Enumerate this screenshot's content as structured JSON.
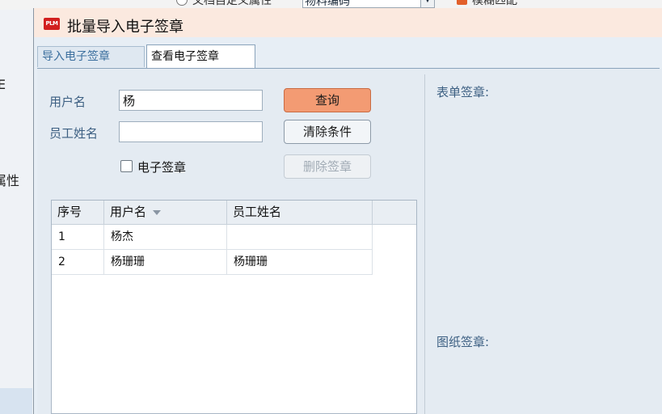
{
  "background": {
    "top_option_label": "文档自定义属性",
    "top_combo_value": "物料编码",
    "top_check_label": "模糊匹配",
    "left_texts": [
      "E",
      "属性"
    ]
  },
  "dialog": {
    "icon_text": "PLM",
    "title": "批量导入电子签章",
    "tabs": [
      {
        "label": "导入电子签章",
        "active": false
      },
      {
        "label": "查看电子签章",
        "active": true
      }
    ]
  },
  "form": {
    "username_label": "用户名",
    "username_value": "杨",
    "employee_label": "员工姓名",
    "employee_value": "",
    "esign_checkbox_label": "电子签章",
    "esign_checked": false,
    "query_button": "查询",
    "clear_button": "清除条件",
    "delete_button": "删除签章"
  },
  "table": {
    "columns": [
      "序号",
      "用户名",
      "员工姓名"
    ],
    "rows": [
      {
        "index": "1",
        "username": "杨杰",
        "employee": ""
      },
      {
        "index": "2",
        "username": "杨珊珊",
        "employee": "杨珊珊"
      }
    ]
  },
  "right_panel": {
    "form_sign_label": "表单签章:",
    "drawing_sign_label": "图纸签章:"
  },
  "colors": {
    "title_bg": "#fbe9df",
    "query_button": "#f39b73",
    "label_text": "#3c5f82"
  }
}
